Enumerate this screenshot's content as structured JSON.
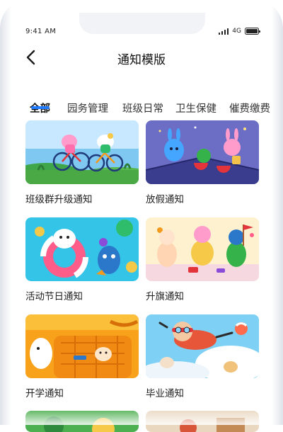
{
  "status_bar": {
    "time": "9:41 AM",
    "network": "4G"
  },
  "header": {
    "title": "通知模版"
  },
  "tabs": [
    {
      "label": "全部",
      "active": true
    },
    {
      "label": "园务管理",
      "active": false
    },
    {
      "label": "班级日常",
      "active": false
    },
    {
      "label": "卫生保健",
      "active": false
    },
    {
      "label": "催费缴费",
      "active": false
    }
  ],
  "templates": [
    {
      "title": "班级群升级通知",
      "image": "kids-riding-bicycles-illustration"
    },
    {
      "title": "放假通知",
      "image": "characters-on-rooftop-night-illustration"
    },
    {
      "title": "活动节日通知",
      "image": "characters-in-swim-ring-illustration"
    },
    {
      "title": "升旗通知",
      "image": "characters-parade-illustration"
    },
    {
      "title": "开学通知",
      "image": "kids-with-school-bag-illustration"
    },
    {
      "title": "毕业通知",
      "image": "boy-flying-with-goggles-illustration"
    }
  ],
  "colors": {
    "accent": "#1f7bff",
    "text_primary": "#111111",
    "text_secondary": "#333333"
  }
}
